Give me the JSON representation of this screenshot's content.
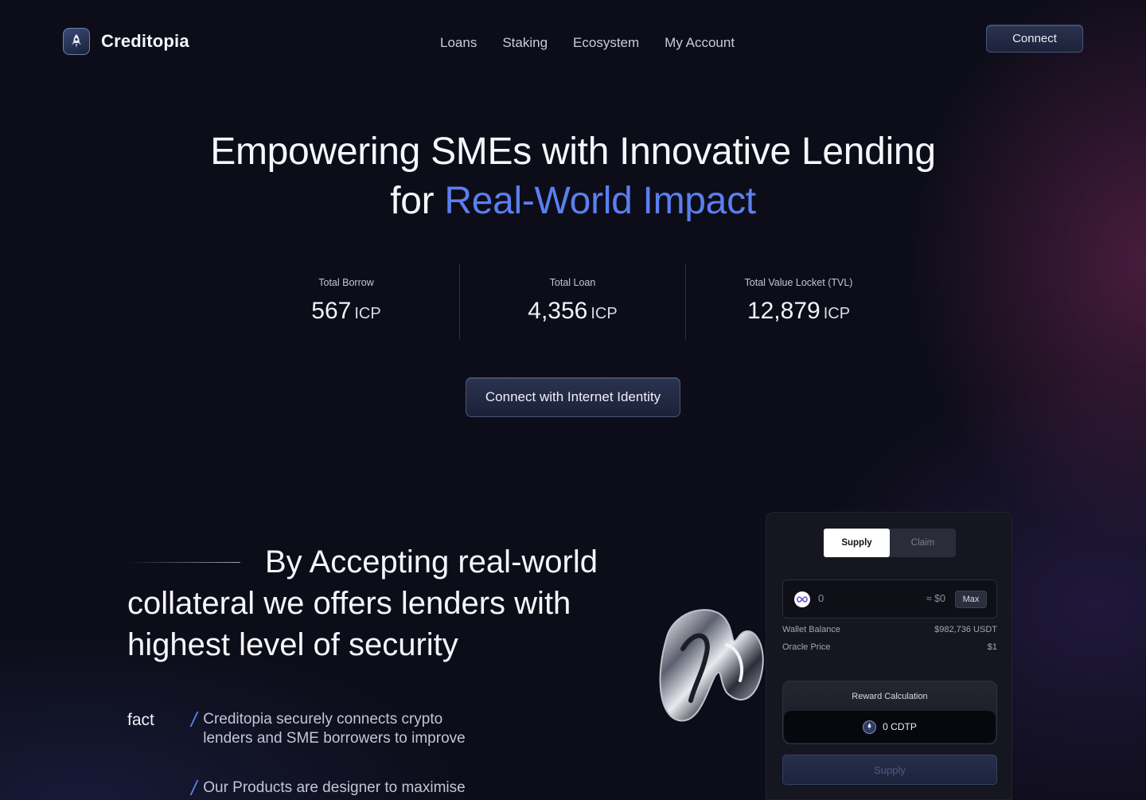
{
  "brand": {
    "name": "Creditopia",
    "icon": "rocket-icon"
  },
  "nav": {
    "items": [
      "Loans",
      "Staking",
      "Ecosystem",
      "My Account"
    ]
  },
  "header": {
    "connect_label": "Connect"
  },
  "hero": {
    "line1": "Empowering SMEs with Innovative Lending",
    "line2_prefix": "for ",
    "line2_accent": "Real-World Impact"
  },
  "stats": [
    {
      "label": "Total Borrow",
      "value": "567",
      "unit": "ICP"
    },
    {
      "label": "Total Loan",
      "value": "4,356",
      "unit": "ICP"
    },
    {
      "label": "Total Value Locket (TVL)",
      "value": "12,879",
      "unit": "ICP"
    }
  ],
  "cta": {
    "label": "Connect with Internet Identity"
  },
  "statement": "By Accepting real-world collateral we offers lenders with highest level of security",
  "facts": {
    "label": "fact",
    "items": [
      "Creditopia securely connects crypto lenders and SME borrowers to improve",
      "Our Products are designer to maximise"
    ]
  },
  "card": {
    "tabs": [
      "Supply",
      "Claim"
    ],
    "amount": "0",
    "approx": "≈ $0",
    "max_label": "Max",
    "wallet_label": "Wallet Balance",
    "wallet_value": "$982,736 USDT",
    "oracle_label": "Oracle Price",
    "oracle_value": "$1",
    "reward_title": "Reward Calculation",
    "reward_value": "0 CDTP",
    "supply_label": "Supply"
  },
  "colors": {
    "accent": "#5b7ff0",
    "background": "#0d0d19"
  }
}
